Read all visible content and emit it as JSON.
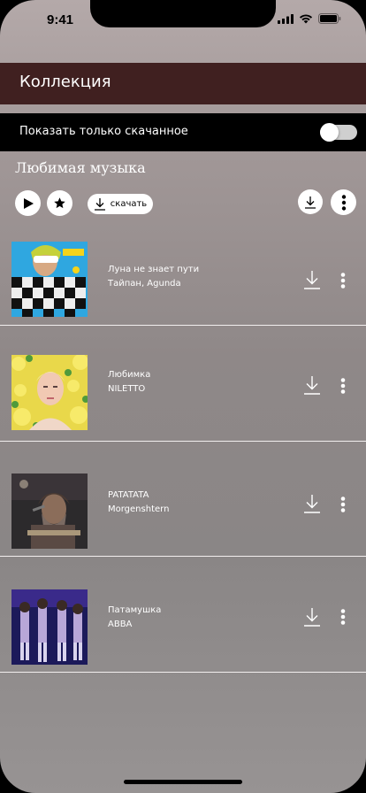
{
  "status_bar": {
    "time": "9:41"
  },
  "header": {
    "title": "Коллекция"
  },
  "filter": {
    "label": "Показать только скачанное",
    "enabled": false
  },
  "playlist": {
    "title": "Любимая музыка",
    "download_label": "скачать"
  },
  "tracks": [
    {
      "title": "Луна не знает пути",
      "artist": "Тайпан, Agunda"
    },
    {
      "title": "Любимка",
      "artist": "NILETTO"
    },
    {
      "title": "PATATATA",
      "artist": "Morgenshtern"
    },
    {
      "title": "Патамушка",
      "artist": "ABBA"
    }
  ],
  "colors": {
    "header_bg": "#402020",
    "filter_bg": "#000000",
    "divider": "#f2eeee"
  },
  "icons": [
    "play-icon",
    "star-icon",
    "download-icon",
    "more-vertical-icon",
    "signal-icon",
    "wifi-icon",
    "battery-icon"
  ]
}
